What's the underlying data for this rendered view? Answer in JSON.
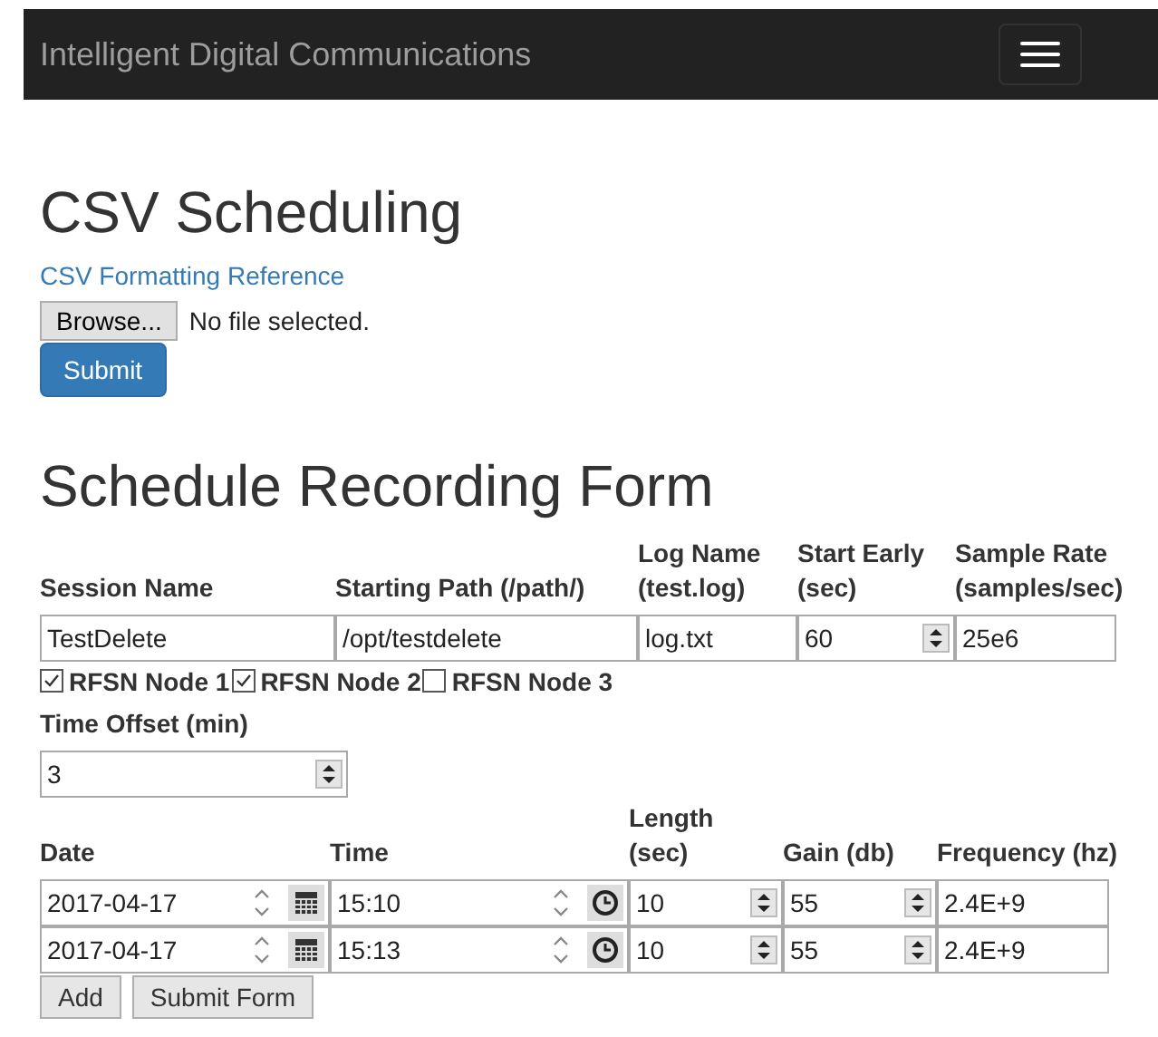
{
  "navbar": {
    "brand": "Intelligent Digital Communications"
  },
  "csv": {
    "title": "CSV Scheduling",
    "link": "CSV Formatting Reference",
    "browse_button": "Browse...",
    "file_status": "No file selected.",
    "submit_button": "Submit"
  },
  "form": {
    "title": "Schedule Recording Form",
    "session_columns": [
      {
        "label": "Session Name",
        "value": "TestDelete",
        "kind": "text"
      },
      {
        "label": "Starting Path (/path/)",
        "value": "/opt/testdelete",
        "kind": "text"
      },
      {
        "label": "Log Name (test.log)",
        "value": "log.txt",
        "kind": "text"
      },
      {
        "label": "Start Early (sec)",
        "value": "60",
        "kind": "number"
      },
      {
        "label": "Sample Rate (samples/sec)",
        "value": "25e6",
        "kind": "text"
      }
    ],
    "nodes": [
      {
        "label": "RFSN Node 1",
        "checked": true
      },
      {
        "label": "RFSN Node 2",
        "checked": true
      },
      {
        "label": "RFSN Node 3",
        "checked": false
      }
    ],
    "time_offset": {
      "label": "Time Offset (min)",
      "value": "3"
    },
    "schedule_columns": [
      "Date",
      "Time",
      "Length (sec)",
      "Gain (db)",
      "Frequency (hz)"
    ],
    "schedule_rows": [
      {
        "cells": [
          {
            "kind": "date",
            "value": "2017-04-17"
          },
          {
            "kind": "time",
            "value": "15:10"
          },
          {
            "kind": "number",
            "value": "10"
          },
          {
            "kind": "number",
            "value": "55"
          },
          {
            "kind": "text",
            "value": "2.4E+9"
          }
        ]
      },
      {
        "cells": [
          {
            "kind": "date",
            "value": "2017-04-17"
          },
          {
            "kind": "time",
            "value": "15:13"
          },
          {
            "kind": "number",
            "value": "10"
          },
          {
            "kind": "number",
            "value": "55"
          },
          {
            "kind": "text",
            "value": "2.4E+9"
          }
        ]
      }
    ],
    "buttons": [
      "Add",
      "Submit Form"
    ]
  }
}
